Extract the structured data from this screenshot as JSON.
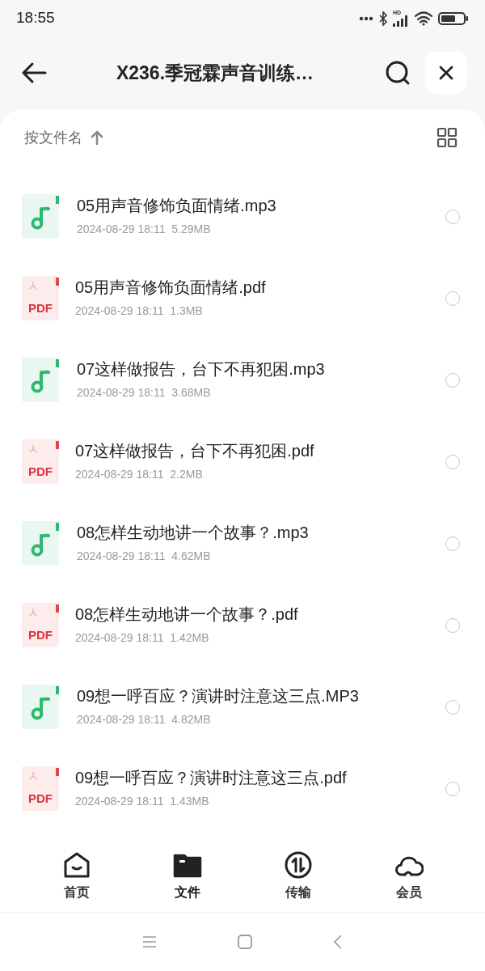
{
  "status_bar": {
    "time": "18:55",
    "network": "HD"
  },
  "header": {
    "title": "X236.季冠霖声音训练…"
  },
  "sort": {
    "label": "按文件名"
  },
  "files": [
    {
      "kind": "audio",
      "name": "05用声音修饰负面情绪.mp3",
      "meta": "2024-08-29 18:11  5.29MB",
      "checked": false
    },
    {
      "kind": "pdf",
      "badge": "PDF",
      "name": "05用声音修饰负面情绪.pdf",
      "meta": "2024-08-29 18:11  1.3MB",
      "checked": false
    },
    {
      "kind": "audio",
      "name": "07这样做报告，台下不再犯困.mp3",
      "meta": "2024-08-29 18:11  3.68MB",
      "checked": false
    },
    {
      "kind": "pdf",
      "badge": "PDF",
      "name": "07这样做报告，台下不再犯困.pdf",
      "meta": "2024-08-29 18:11  2.2MB",
      "checked": false
    },
    {
      "kind": "audio",
      "name": "08怎样生动地讲一个故事？.mp3",
      "meta": "2024-08-29 18:11  4.62MB",
      "checked": false
    },
    {
      "kind": "pdf",
      "badge": "PDF",
      "name": "08怎样生动地讲一个故事？.pdf",
      "meta": "2024-08-29 18:11  1.42MB",
      "checked": false
    },
    {
      "kind": "audio",
      "name": "09想一呼百应？演讲时注意这三点.MP3",
      "meta": "2024-08-29 18:11  4.82MB",
      "checked": false
    },
    {
      "kind": "pdf",
      "badge": "PDF",
      "name": "09想一呼百应？演讲时注意这三点.pdf",
      "meta": "2024-08-29 18:11  1.43MB",
      "checked": false
    }
  ],
  "tabs": [
    {
      "kind": "home",
      "label": "首页",
      "selected": false
    },
    {
      "kind": "files",
      "label": "文件",
      "selected": true
    },
    {
      "kind": "transfer",
      "label": "传输",
      "selected": false
    },
    {
      "kind": "vip",
      "label": "会员",
      "selected": false
    }
  ]
}
